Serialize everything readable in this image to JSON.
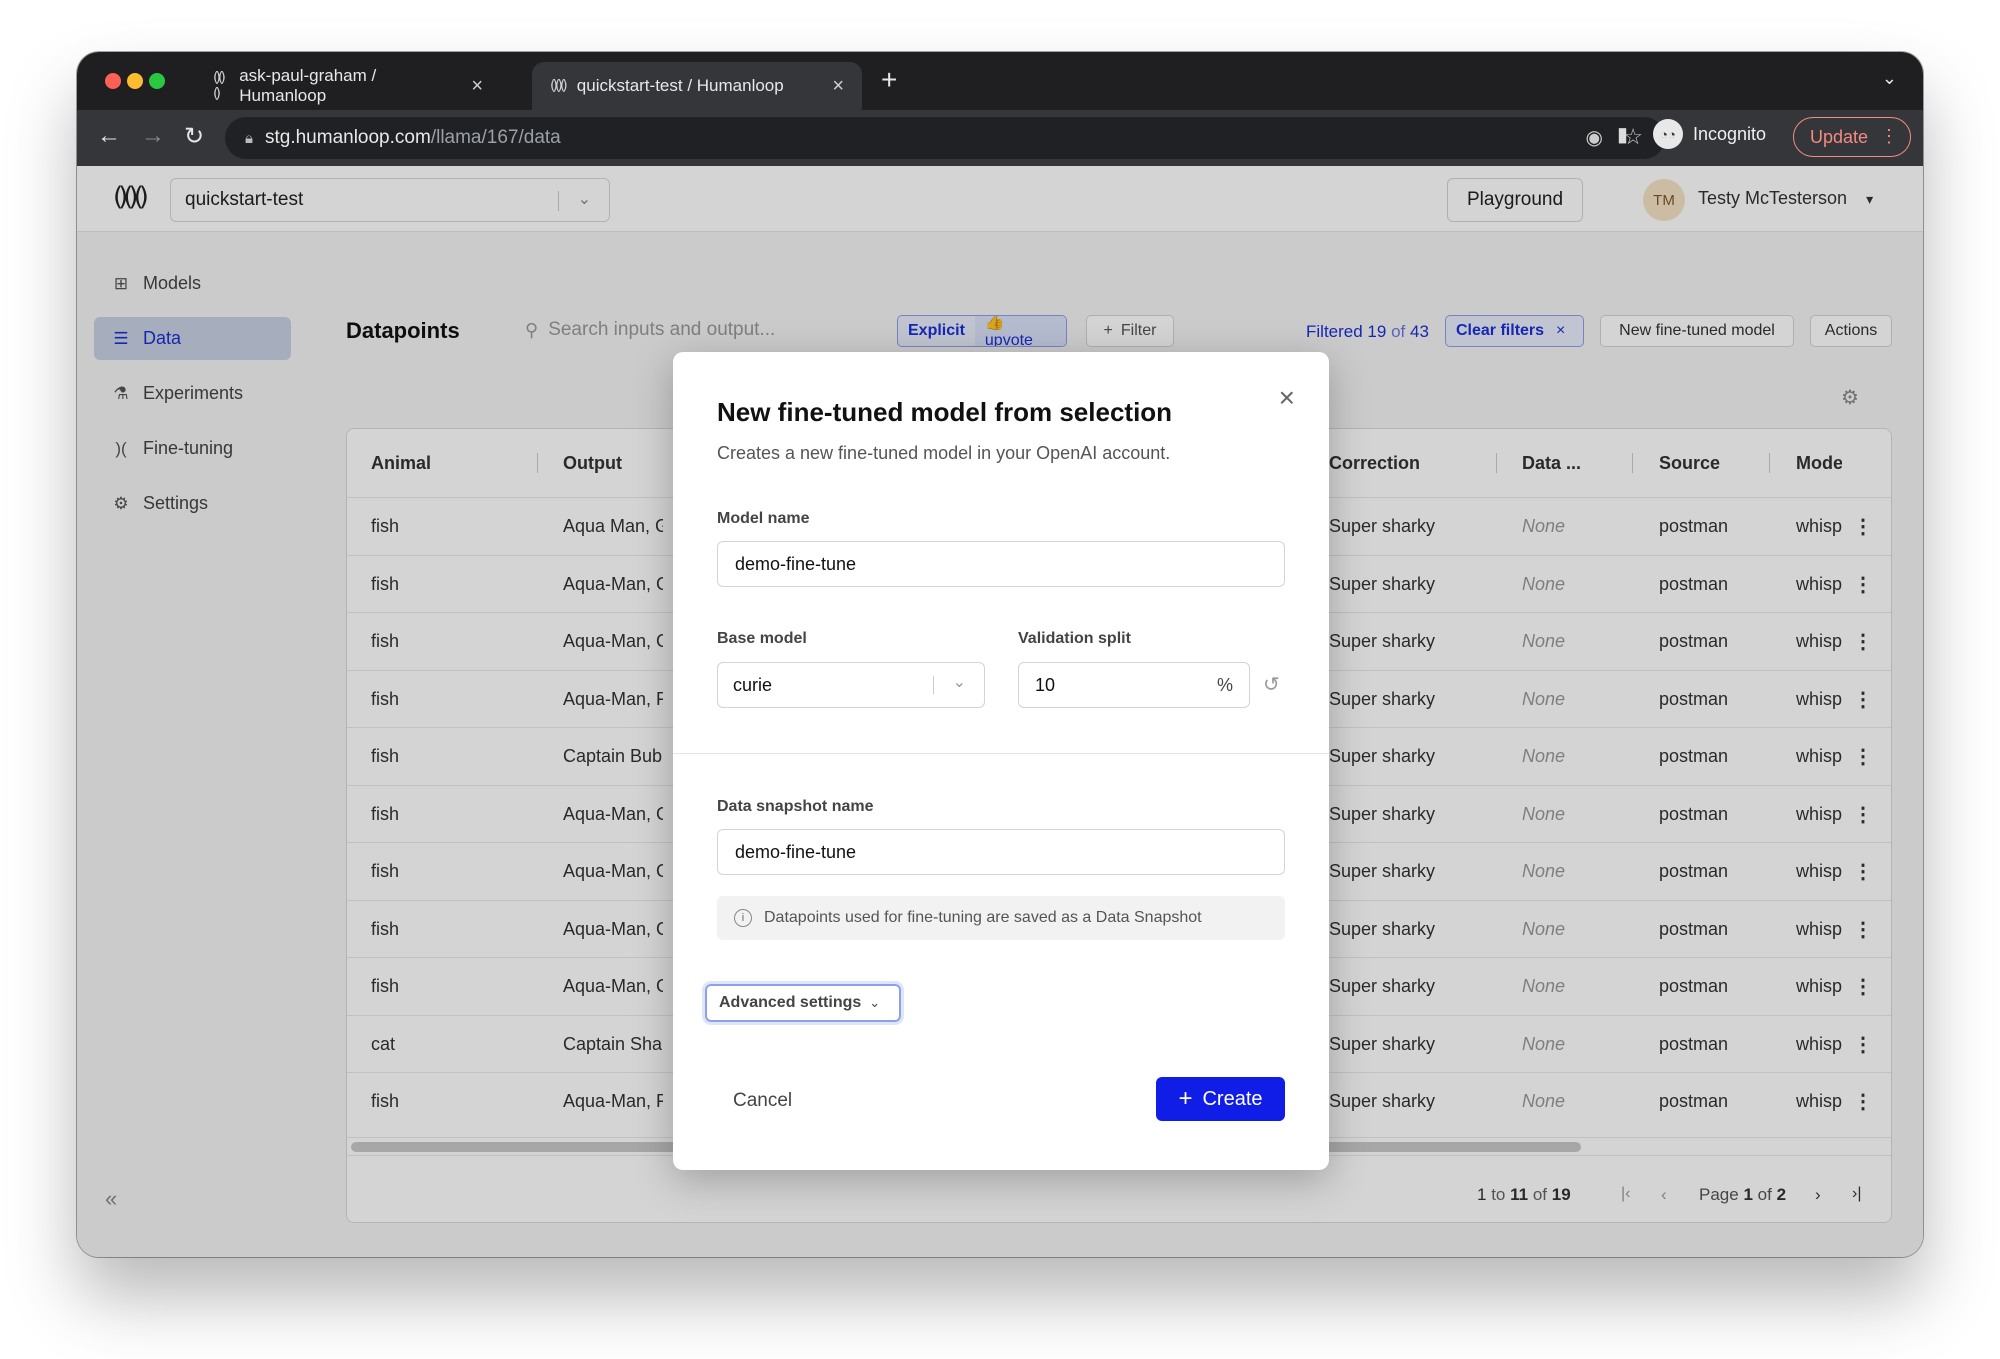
{
  "browser": {
    "tabs": [
      {
        "label": "ask-paul-graham / Humanloop"
      },
      {
        "label": "quickstart-test / Humanloop"
      }
    ],
    "url_host": "stg.humanloop.com",
    "url_path": "/llama/167/data",
    "profile": "Incognito",
    "update_label": "Update"
  },
  "topnav": {
    "project": "quickstart-test",
    "playground_label": "Playground",
    "avatar_initials": "TM",
    "username": "Testy McTesterson"
  },
  "sidebar": {
    "items": [
      {
        "label": "Models",
        "icon": "grid-icon"
      },
      {
        "label": "Data",
        "icon": "database-icon"
      },
      {
        "label": "Experiments",
        "icon": "flask-icon"
      },
      {
        "label": "Fine-tuning",
        "icon": "tune-icon"
      },
      {
        "label": "Settings",
        "icon": "gear-icon"
      }
    ],
    "active": "Data"
  },
  "toolbar": {
    "title": "Datapoints",
    "search_placeholder": "Search inputs and output...",
    "chip_explicit": "Explicit",
    "chip_upvote": "👍 upvote",
    "filter_label": "Filter",
    "filtered_prefix": "Filtered",
    "filtered_count": "19",
    "filtered_of": "of",
    "filtered_total": "43",
    "clear_filters": "Clear filters",
    "new_fine_tuned": "New fine-tuned model",
    "actions": "Actions"
  },
  "table": {
    "headers": [
      "Animal",
      "Output",
      "Correction",
      "Data ...",
      "Source",
      "Mode"
    ],
    "rows": [
      {
        "animal": "fish",
        "output": "Aqua Man, Gi",
        "correction": "Super sharky",
        "data": "None",
        "source": "postman",
        "model": "whisp"
      },
      {
        "animal": "fish",
        "output": "Aqua-Man, G",
        "correction": "Super sharky",
        "data": "None",
        "source": "postman",
        "model": "whisp"
      },
      {
        "animal": "fish",
        "output": "Aqua-Man, G",
        "correction": "Super sharky",
        "data": "None",
        "source": "postman",
        "model": "whisp"
      },
      {
        "animal": "fish",
        "output": "Aqua-Man, Fi",
        "correction": "Super sharky",
        "data": "None",
        "source": "postman",
        "model": "whisp"
      },
      {
        "animal": "fish",
        "output": "Captain Bubb",
        "correction": "Super sharky",
        "data": "None",
        "source": "postman",
        "model": "whisp"
      },
      {
        "animal": "fish",
        "output": "Aqua-Man, G",
        "correction": "Super sharky",
        "data": "None",
        "source": "postman",
        "model": "whisp"
      },
      {
        "animal": "fish",
        "output": "Aqua-Man, G",
        "correction": "Super sharky",
        "data": "None",
        "source": "postman",
        "model": "whisp"
      },
      {
        "animal": "fish",
        "output": "Aqua-Man, G",
        "correction": "Super sharky",
        "data": "None",
        "source": "postman",
        "model": "whisp"
      },
      {
        "animal": "fish",
        "output": "Aqua-Man, G",
        "correction": "Super sharky",
        "data": "None",
        "source": "postman",
        "model": "whisp"
      },
      {
        "animal": "cat",
        "output": "Captain Shar",
        "correction": "Super sharky",
        "data": "None",
        "source": "postman",
        "model": "whisp"
      },
      {
        "animal": "fish",
        "output": "Aqua-Man, Fi",
        "correction": "Super sharky",
        "data": "None",
        "source": "postman",
        "model": "whisp"
      }
    ],
    "range_start": "1",
    "range_to": "to",
    "range_end": "11",
    "range_of": "of",
    "range_total": "19",
    "page_label": "Page",
    "page_current": "1",
    "page_of": "of",
    "page_total": "2"
  },
  "modal": {
    "title": "New fine-tuned model from selection",
    "subtitle": "Creates a new fine-tuned model in your OpenAI account.",
    "model_name_label": "Model name",
    "model_name_value": "demo-fine-tune",
    "base_model_label": "Base model",
    "base_model_value": "curie",
    "validation_split_label": "Validation split",
    "validation_split_value": "10",
    "validation_split_unit": "%",
    "snapshot_label": "Data snapshot name",
    "snapshot_value": "demo-fine-tune",
    "info_text": "Datapoints used for fine-tuning are saved as a Data Snapshot",
    "advanced_label": "Advanced settings",
    "cancel_label": "Cancel",
    "create_label": "Create"
  },
  "colors": {
    "primary": "#0f1de6",
    "link": "#1b2fd6",
    "active_nav": "#c8d0e3",
    "update_accent": "#f28b82"
  }
}
